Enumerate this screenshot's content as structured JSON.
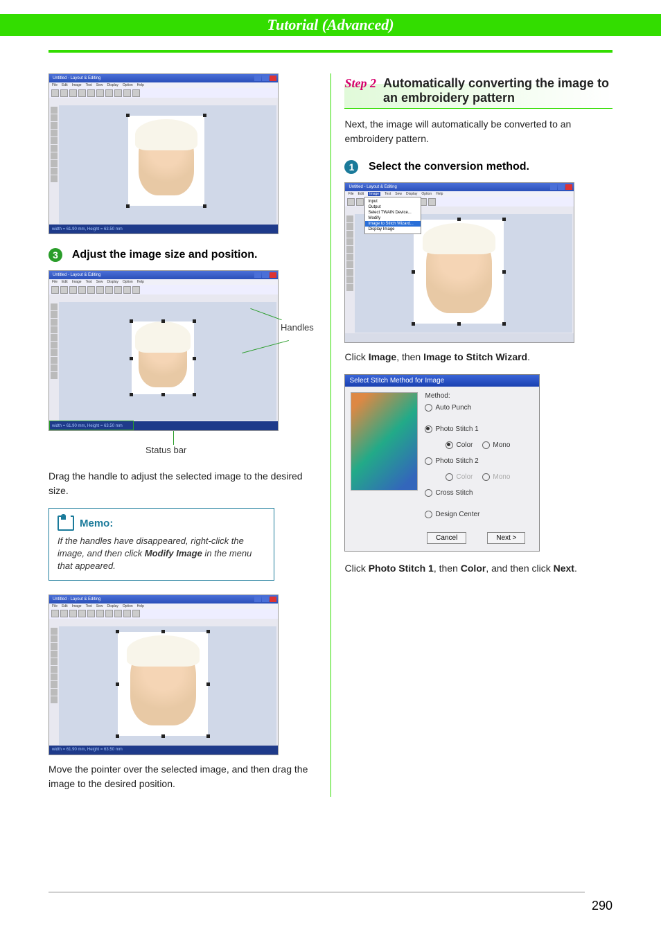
{
  "header": {
    "title": "Tutorial (Advanced)"
  },
  "page_number": "290",
  "left": {
    "step3": {
      "num": "3",
      "heading": "Adjust the image size and position.",
      "handles_label": "Handles",
      "statusbar_label": "Status bar",
      "drag_text": "Drag the handle to adjust the selected image to the desired size.",
      "move_text": "Move the pointer over the selected image, and then drag the image to the desired position."
    },
    "memo": {
      "title": "Memo:",
      "text_pre": "If the handles have disappeared, right-click the image, and then click ",
      "bold": "Modify Image",
      "text_post": " in the menu that appeared."
    },
    "screenshots": {
      "title": "Untitled - Layout & Editing",
      "menus": [
        "File",
        "Edit",
        "Image",
        "Text",
        "Sew",
        "Display",
        "Option",
        "Help"
      ],
      "status": "width = 61.90 mm, Height = 63.50 mm"
    }
  },
  "right": {
    "section": {
      "step_label": "Step 2",
      "title": "Automatically converting the image to an embroidery pattern"
    },
    "intro": "Next, the image will automatically be converted to an embroidery pattern.",
    "step1": {
      "num": "1",
      "heading": "Select the conversion method.",
      "click_text_pre": "Click ",
      "click_bold1": "Image",
      "click_mid": ", then ",
      "click_bold2": "Image to Stitch Wizard",
      "click_post": "."
    },
    "dialog": {
      "title": "Select Stitch Method for Image",
      "method_label": "Method:",
      "opt_auto": "Auto Punch",
      "opt_ps1": "Photo Stitch 1",
      "opt_color": "Color",
      "opt_mono": "Mono",
      "opt_ps2": "Photo Stitch 2",
      "opt_color2": "Color",
      "opt_mono2": "Mono",
      "opt_cross": "Cross Stitch",
      "opt_design": "Design Center",
      "btn_cancel": "Cancel",
      "btn_next": "Next >"
    },
    "final": {
      "pre": "Click ",
      "b1": "Photo Stitch 1",
      "mid1": ", then ",
      "b2": "Color",
      "mid2": ", and then click ",
      "b3": "Next",
      "post": "."
    }
  }
}
